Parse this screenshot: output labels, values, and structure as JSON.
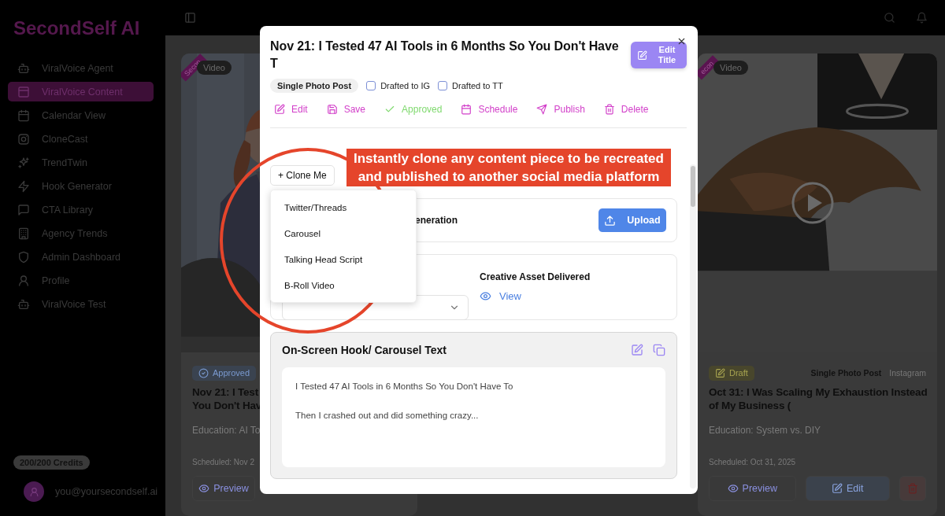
{
  "sidebar": {
    "logo": "SecondSelf AI",
    "items": [
      {
        "label": "ViralVoice Agent",
        "selected": false
      },
      {
        "label": "ViralVoice Content",
        "selected": true
      },
      {
        "label": "Calendar View",
        "selected": false
      },
      {
        "label": "CloneCast",
        "selected": false
      },
      {
        "label": "TrendTwin",
        "selected": false
      },
      {
        "label": "Hook Generator",
        "selected": false
      },
      {
        "label": "CTA Library",
        "selected": false
      },
      {
        "label": "Agency Trends",
        "selected": false
      },
      {
        "label": "Admin Dashboard",
        "selected": false
      },
      {
        "label": "Profile",
        "selected": false
      },
      {
        "label": "ViralVoice Test",
        "selected": false
      }
    ],
    "credits": "200/200 Credits",
    "user_email": "you@yoursecondself.ai"
  },
  "cards": [
    {
      "ribbon": "Secon",
      "media_badge": "Video",
      "status": {
        "label": "Approved",
        "kind": "approved"
      },
      "title_lines": [
        "Nov 21: I Test",
        "You Don't Hav"
      ],
      "description": "Education: AI To",
      "scheduled": "Scheduled: Nov 2",
      "preview_button": "Preview"
    },
    {
      "ribbon": "econ",
      "media_badge": "Video",
      "status": {
        "label": "Draft",
        "kind": "draft"
      },
      "post_type": "Single Photo Post",
      "platform": "Instagram",
      "title_lines": [
        "Oct 31: I Was Scaling My Exhaustion Instead",
        "of My Business ("
      ],
      "description": "Education: System vs. DIY",
      "scheduled": "Scheduled: Oct 31, 2025",
      "preview_button": "Preview",
      "edit_button": "Edit"
    }
  ],
  "modal": {
    "title": "Nov 21: I Tested 47 AI Tools in 6 Months So You Don't Have T",
    "edit_title_button": "Edit Title",
    "post_type": "Single Photo Post",
    "checkboxes": [
      {
        "label": "Drafted to IG",
        "checked": false
      },
      {
        "label": "Drafted to TT",
        "checked": false
      }
    ],
    "actions": [
      {
        "label": "Edit",
        "kind": "default"
      },
      {
        "label": "Save",
        "kind": "default"
      },
      {
        "label": "Approved",
        "kind": "approved"
      },
      {
        "label": "Schedule",
        "kind": "default"
      },
      {
        "label": "Publish",
        "kind": "default"
      },
      {
        "label": "Delete",
        "kind": "default"
      }
    ],
    "clone_button": "+ Clone Me",
    "clone_menu": {
      "expanded": true,
      "items": [
        "Twitter/Threads",
        "Carousel",
        "Talking Head Script",
        "B-Roll Video"
      ]
    },
    "sections": [
      {
        "kind": "upload",
        "label": "eneration",
        "button": "Upload"
      },
      {
        "kind": "asset",
        "label": "Creative Asset Delivered",
        "link": "View"
      },
      {
        "kind": "text",
        "title": "On-Screen Hook/ Carousel Text",
        "paragraphs": [
          "I Tested 47 AI Tools in 6 Months So You Don't Have To",
          "Then I crashed out and did something crazy..."
        ]
      }
    ]
  },
  "annotation": {
    "callout": "Instantly clone any content piece to be recreated and published to another social media platform"
  }
}
